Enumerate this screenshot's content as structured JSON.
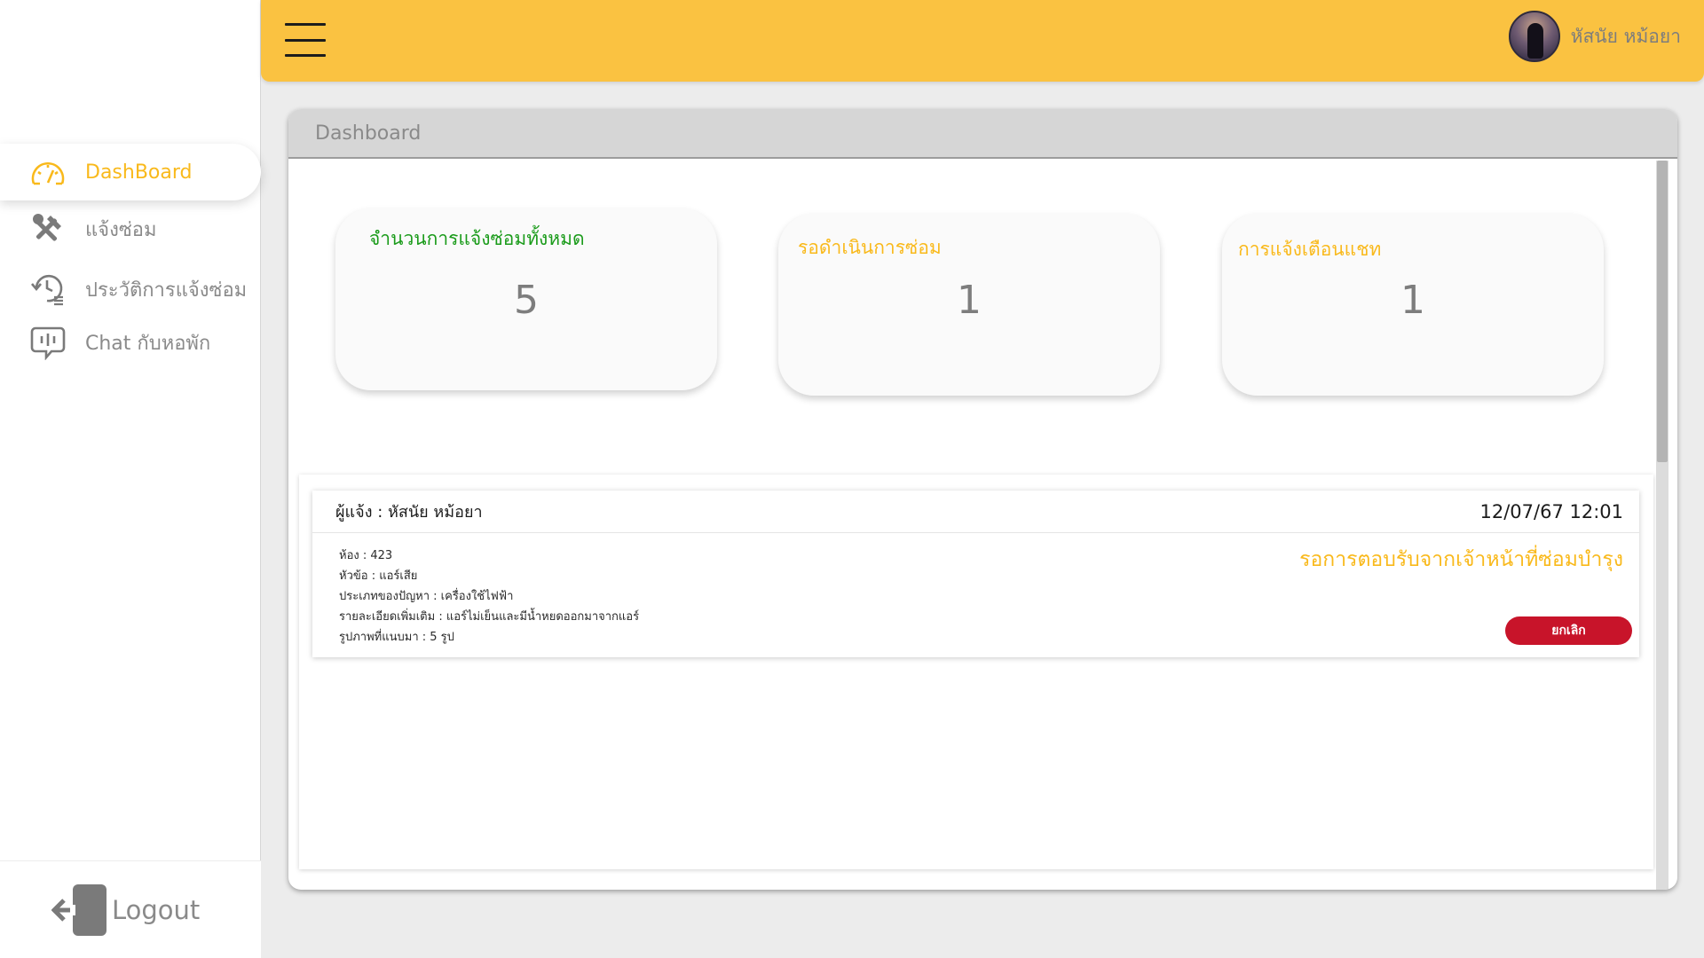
{
  "sidebar": {
    "items": [
      {
        "label": "DashBoard",
        "icon": "speedometer-icon",
        "active": true
      },
      {
        "label": "แจ้งซ่อม",
        "icon": "tools-icon",
        "active": false
      },
      {
        "label": "ประวัติการแจ้งซ่อม",
        "icon": "history-icon",
        "active": false
      },
      {
        "label": "Chat กับหอพัก",
        "icon": "chat-icon",
        "active": false
      }
    ],
    "logout_label": "Logout"
  },
  "topbar": {
    "user_name": "หัสนัย หม้อยา",
    "accent_color": "#fac241"
  },
  "panel": {
    "title": "Dashboard"
  },
  "stats": [
    {
      "title": "จำนวนการแจ้งซ่อมทั้งหมด",
      "value": "5",
      "color": "#1a9b1a"
    },
    {
      "title": "รอดำเนินการซ่อม",
      "value": "1",
      "color": "#f9b91b"
    },
    {
      "title": "การแจ้งเตือนแชท",
      "value": "1",
      "color": "#f9b91b"
    }
  ],
  "report": {
    "reporter": "ผู้แจ้ง : หัสนัย หม้อยา",
    "datetime": "12/07/67 12:01",
    "details": [
      "ห้อง : 423",
      "หัวข้อ : แอร์เสีย",
      "ประเภทของปัญหา : เครื่องใช้ไฟฟ้า",
      "รายละเอียดเพิ่มเติม : แอร์ไม่เย็นและมีน้ำหยดออกมาจากแอร์",
      "รูปภาพที่แนบมา : 5 รูป"
    ],
    "status": "รอการตอบรับจากเจ้าหน้าที่ซ่อมบำรุง",
    "cancel_label": "ยกเลิก",
    "cancel_color": "#c8142a"
  }
}
